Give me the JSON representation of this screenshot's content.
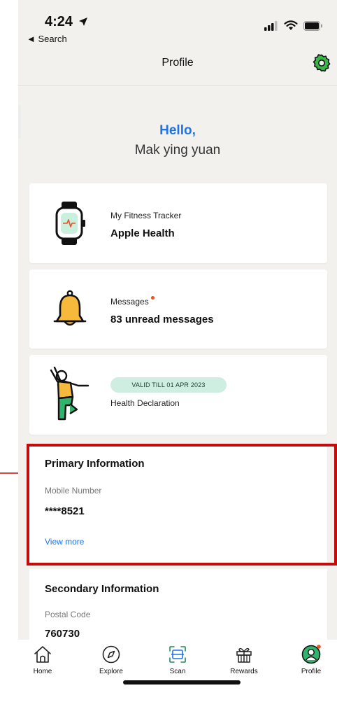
{
  "status_bar": {
    "time": "4:24",
    "back_label": "◄ Search"
  },
  "header": {
    "title": "Profile"
  },
  "greeting": {
    "hello": "Hello,",
    "name": "Mak ying yuan"
  },
  "cards": {
    "fitness": {
      "label": "My Fitness Tracker",
      "value": "Apple Health"
    },
    "messages": {
      "label": "Messages",
      "value": "83 unread messages"
    },
    "health": {
      "badge": "VALID TILL 01 APR 2023",
      "label": "Health Declaration"
    }
  },
  "primary_info": {
    "title": "Primary Information",
    "field_label": "Mobile Number",
    "field_value": "****8521",
    "link": "View more"
  },
  "secondary_info": {
    "title": "Secondary Information",
    "field_label": "Postal Code",
    "field_value": "760730"
  },
  "tab_bar": {
    "items": [
      {
        "label": "Home",
        "icon": "home-icon"
      },
      {
        "label": "Explore",
        "icon": "compass-icon"
      },
      {
        "label": "Scan",
        "icon": "scan-icon"
      },
      {
        "label": "Rewards",
        "icon": "gift-icon"
      },
      {
        "label": "Profile",
        "icon": "profile-icon"
      }
    ]
  },
  "colors": {
    "accent": "#1e73e8",
    "brand_green": "#1f8a5a",
    "notification": "#e5532a",
    "highlight": "#c30d0d",
    "badge_bg": "#cfeee2"
  }
}
